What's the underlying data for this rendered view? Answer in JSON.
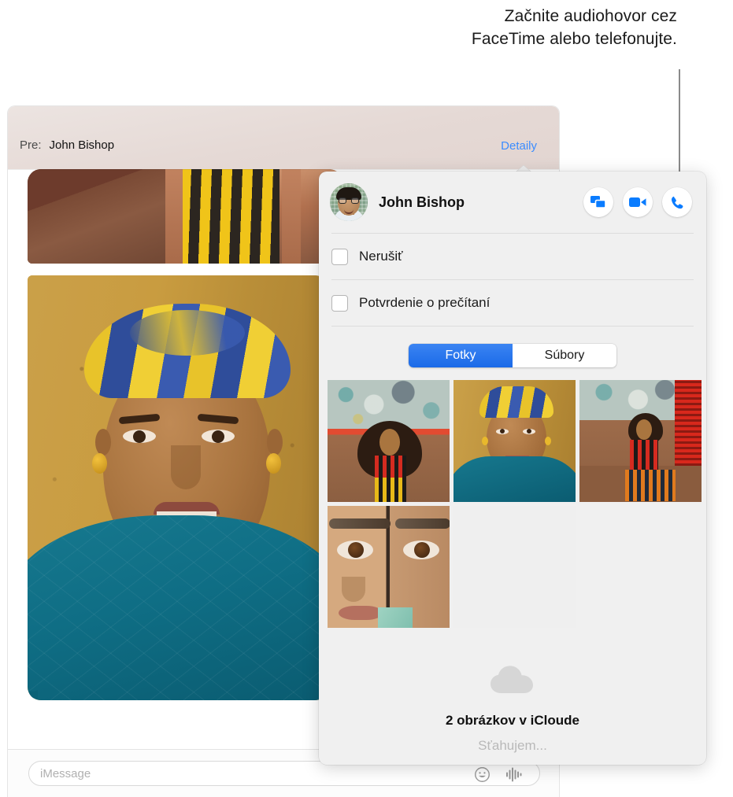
{
  "callout": {
    "text": "Začnite audiohovor cez FaceTime alebo telefonujte.",
    "line_color": "#8a8a8a"
  },
  "window": {
    "toolbar": {
      "to_label": "Pre:",
      "to_value": "John Bishop",
      "details_label": "Detaily",
      "details_link_color": "#3b8cff"
    },
    "compose": {
      "placeholder": "iMessage",
      "value": "",
      "emoji_icon": "smiley-face-icon",
      "audio_icon": "audio-waveform-icon"
    },
    "bubbles": [
      {
        "kind": "image-attachment",
        "description": "striped-dress-photo"
      },
      {
        "kind": "image-attachment",
        "description": "portrait-headwrap-photo"
      }
    ]
  },
  "popover": {
    "contact_name": "John Bishop",
    "avatar": "contact-avatar",
    "actions": [
      {
        "name": "screen-share",
        "icon": "screen-share-icon",
        "color": "#0a7cff"
      },
      {
        "name": "facetime-video",
        "icon": "video-camera-icon",
        "color": "#0a7cff"
      },
      {
        "name": "facetime-audio",
        "icon": "phone-icon",
        "color": "#0a7cff"
      }
    ],
    "options": [
      {
        "label": "Nerušiť",
        "checked": false
      },
      {
        "label": "Potvrdenie o prečítaní",
        "checked": false
      }
    ],
    "tabs": [
      {
        "label": "Fotky",
        "active": true
      },
      {
        "label": "Súbory",
        "active": false
      }
    ],
    "photos": [
      {
        "name": "photo-1",
        "alt": "woman-sitting-teal-wall"
      },
      {
        "name": "photo-2",
        "alt": "portrait-headwrap"
      },
      {
        "name": "photo-3",
        "alt": "woman-seated-red-grill"
      },
      {
        "name": "photo-4",
        "alt": "two-faces-closeup"
      }
    ],
    "icloud": {
      "icon": "cloud-icon",
      "title": "2 obrázkov v iCloude",
      "status": "Sťahujem..."
    }
  },
  "colors": {
    "accent": "#0a7cff",
    "link": "#3b8cff",
    "popover_bg": "#f0f0f0",
    "separator": "#dcdcdc",
    "status_text": "#b9b9b9"
  }
}
